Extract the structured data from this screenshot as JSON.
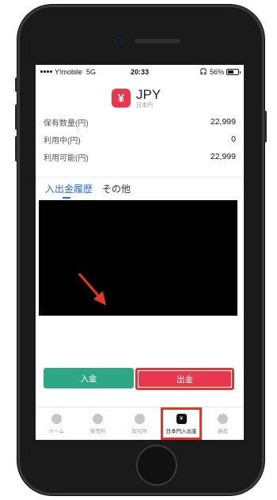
{
  "status_bar": {
    "carrier": "Y!mobile",
    "network": "5G",
    "time": "20:33",
    "battery": "56%",
    "battery_level": 0.56
  },
  "currency": {
    "code": "JPY",
    "name": "日本円",
    "badge_symbol": "¥",
    "badge_color": "#e8374f"
  },
  "balances": [
    {
      "label": "保有数量(円)",
      "value": "22,999"
    },
    {
      "label": "利用中(円)",
      "value": "0"
    },
    {
      "label": "利用可能(円)",
      "value": "22,999"
    }
  ],
  "tabs": [
    {
      "label": "入出金履歴",
      "active": true
    },
    {
      "label": "その他",
      "active": false
    }
  ],
  "actions": {
    "deposit_label": "入金",
    "withdraw_label": "出金",
    "deposit_color": "#2ea784",
    "withdraw_color": "#e8374f",
    "highlight_color": "#e4352b"
  },
  "bottom_nav": [
    {
      "label": "ホーム",
      "icon": "home-icon"
    },
    {
      "label": "販売所",
      "icon": "exchange-icon"
    },
    {
      "label": "取引所",
      "icon": "trade-icon"
    },
    {
      "label": "日本円入出金",
      "icon": "wallet-icon",
      "active": true
    },
    {
      "label": "資産",
      "icon": "assets-icon"
    }
  ]
}
